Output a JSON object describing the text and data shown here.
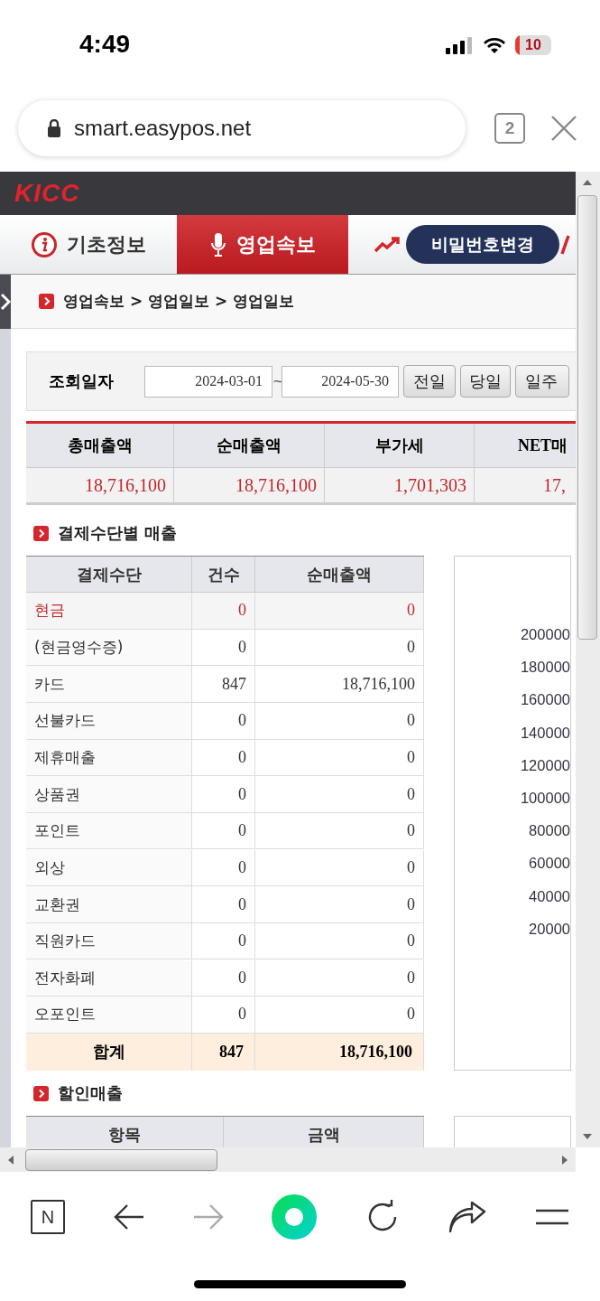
{
  "status_bar": {
    "time": "4:49",
    "battery": "10"
  },
  "browser": {
    "url": "smart.easypos.net",
    "tab_count": "2"
  },
  "header": {
    "logo": "KICC"
  },
  "nav": {
    "tabs": [
      {
        "kind": "info",
        "label": "기초정보",
        "selected": false
      },
      {
        "kind": "mic",
        "label": "영업속보",
        "selected": true
      },
      {
        "kind": "trend",
        "selected": false
      }
    ],
    "password_button": "비밀번호변경"
  },
  "breadcrumb": "영업속보 > 영업일보 > 영업일보",
  "search": {
    "label": "조회일자",
    "from": "2024-03-01",
    "separator": "~",
    "to": "2024-05-30",
    "buttons": [
      "전일",
      "당일",
      "일주"
    ]
  },
  "summary": {
    "columns": [
      "총매출액",
      "순매출액",
      "부가세",
      "NET매"
    ],
    "values": [
      "18,716,100",
      "18,716,100",
      "1,701,303",
      "17,"
    ]
  },
  "payment_section": {
    "title": "결제수단별 매출",
    "columns": [
      "결제수단",
      "건수",
      "순매출액"
    ],
    "rows": [
      {
        "method": "현금",
        "count": "0",
        "amount": "0",
        "alert": true
      },
      {
        "method": "(현금영수증)",
        "count": "0",
        "amount": "0",
        "alert": false
      },
      {
        "method": "카드",
        "count": "847",
        "amount": "18,716,100",
        "alert": false
      },
      {
        "method": "선불카드",
        "count": "0",
        "amount": "0",
        "alert": false
      },
      {
        "method": "제휴매출",
        "count": "0",
        "amount": "0",
        "alert": false
      },
      {
        "method": "상품권",
        "count": "0",
        "amount": "0",
        "alert": false
      },
      {
        "method": "포인트",
        "count": "0",
        "amount": "0",
        "alert": false
      },
      {
        "method": "외상",
        "count": "0",
        "amount": "0",
        "alert": false
      },
      {
        "method": "교환권",
        "count": "0",
        "amount": "0",
        "alert": false
      },
      {
        "method": "직원카드",
        "count": "0",
        "amount": "0",
        "alert": false
      },
      {
        "method": "전자화폐",
        "count": "0",
        "amount": "0",
        "alert": false
      },
      {
        "method": "오포인트",
        "count": "0",
        "amount": "0",
        "alert": false
      }
    ],
    "total": {
      "label": "합계",
      "count": "847",
      "amount": "18,716,100"
    },
    "axis_labels": [
      "200000",
      "180000",
      "160000",
      "140000",
      "120000",
      "100000",
      "80000",
      "60000",
      "40000",
      "20000"
    ]
  },
  "discount_section": {
    "title": "할인매출",
    "columns": [
      "항목",
      "금액"
    ]
  },
  "toolbar": {
    "home_label": "N",
    "forward_disabled": true
  }
}
